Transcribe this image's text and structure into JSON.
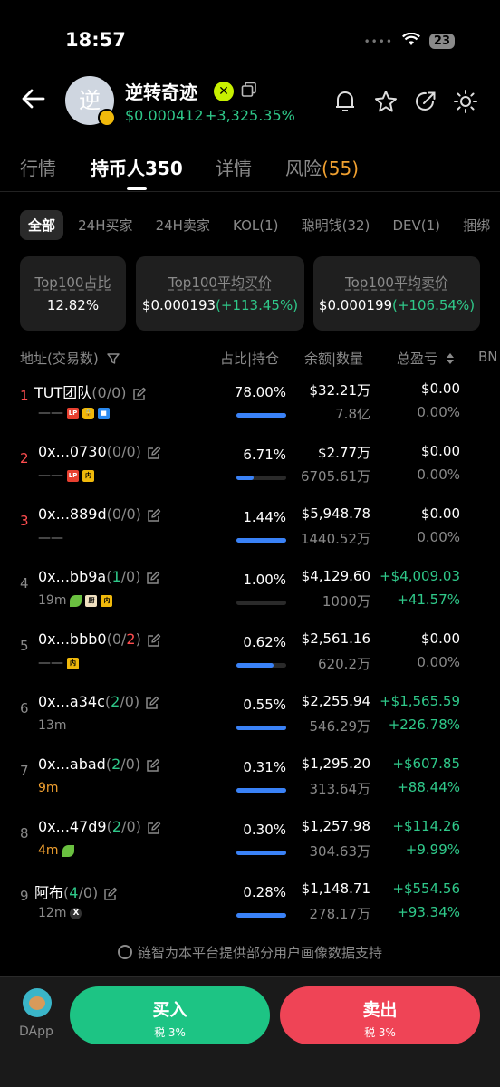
{
  "status": {
    "time": "18:57",
    "battery": "23"
  },
  "token": {
    "avatar_char": "逆",
    "name": "逆转奇迹",
    "price": "$0.000412",
    "change": "+3,325.35%"
  },
  "tabs": [
    {
      "label": "行情"
    },
    {
      "label": "持币人350"
    },
    {
      "label": "详情"
    },
    {
      "label": "风险",
      "count": "(55)"
    }
  ],
  "filters": [
    "全部",
    "24H买家",
    "24H卖家",
    "KOL(1)",
    "聪明钱(32)",
    "DEV(1)",
    "捆绑"
  ],
  "stats": [
    {
      "label": "Top100占比",
      "value": "12.82%",
      "extra": ""
    },
    {
      "label": "Top100平均买价",
      "value": "$0.000193",
      "extra": "(+113.45%)"
    },
    {
      "label": "Top100平均卖价",
      "value": "$0.000199",
      "extra": "(+106.54%)"
    }
  ],
  "table_header": {
    "address": "地址(交易数)",
    "share": "占比|持仓",
    "balance": "余额|数量",
    "pnl": "总盈亏",
    "extra": "BN"
  },
  "rows": [
    {
      "rank": "1",
      "name": "TUT团队",
      "c1": "0",
      "c2": "0",
      "c1_color": "w",
      "c2_color": "w",
      "time": "——",
      "time_color": "",
      "tags": [
        "lp",
        "lock",
        "sq"
      ],
      "pct": "78.00%",
      "share": 1.0,
      "balance": "$32.21万",
      "qty": "7.8亿",
      "pnl": "$0.00",
      "pnl_pct": "0.00%",
      "positive": false
    },
    {
      "rank": "2",
      "name": "0x...0730",
      "c1": "0",
      "c2": "0",
      "c1_color": "w",
      "c2_color": "w",
      "time": "——",
      "time_color": "",
      "tags": [
        "lp",
        "nei"
      ],
      "pct": "6.71%",
      "share": 0.35,
      "balance": "$2.77万",
      "qty": "6705.61万",
      "pnl": "$0.00",
      "pnl_pct": "0.00%",
      "positive": false
    },
    {
      "rank": "3",
      "name": "0x...889d",
      "c1": "0",
      "c2": "0",
      "c1_color": "w",
      "c2_color": "w",
      "time": "——",
      "time_color": "",
      "tags": [],
      "pct": "1.44%",
      "share": 1.0,
      "balance": "$5,948.78",
      "qty": "1440.52万",
      "pnl": "$0.00",
      "pnl_pct": "0.00%",
      "positive": false
    },
    {
      "rank": "4",
      "name": "0x...bb9a",
      "c1": "1",
      "c2": "0",
      "c1_color": "g",
      "c2_color": "w",
      "time": "19m",
      "time_color": "",
      "tags": [
        "leaf",
        "chef",
        "nei"
      ],
      "pct": "1.00%",
      "share": 0.0,
      "balance": "$4,129.60",
      "qty": "1000万",
      "pnl": "+$4,009.03",
      "pnl_pct": "+41.57%",
      "positive": true
    },
    {
      "rank": "5",
      "name": "0x...bbb0",
      "c1": "0",
      "c2": "2",
      "c1_color": "w",
      "c2_color": "r",
      "time": "——",
      "time_color": "",
      "tags": [
        "nei"
      ],
      "pct": "0.62%",
      "share": 0.75,
      "balance": "$2,561.16",
      "qty": "620.2万",
      "pnl": "$0.00",
      "pnl_pct": "0.00%",
      "positive": false
    },
    {
      "rank": "6",
      "name": "0x...a34c",
      "c1": "2",
      "c2": "0",
      "c1_color": "g",
      "c2_color": "w",
      "time": "13m",
      "time_color": "",
      "tags": [],
      "pct": "0.55%",
      "share": 1.0,
      "balance": "$2,255.94",
      "qty": "546.29万",
      "pnl": "+$1,565.59",
      "pnl_pct": "+226.78%",
      "positive": true
    },
    {
      "rank": "7",
      "name": "0x...abad",
      "c1": "2",
      "c2": "0",
      "c1_color": "g",
      "c2_color": "w",
      "time": "9m",
      "time_color": "orange",
      "tags": [],
      "pct": "0.31%",
      "share": 1.0,
      "balance": "$1,295.20",
      "qty": "313.64万",
      "pnl": "+$607.85",
      "pnl_pct": "+88.44%",
      "positive": true
    },
    {
      "rank": "8",
      "name": "0x...47d9",
      "c1": "2",
      "c2": "0",
      "c1_color": "g",
      "c2_color": "w",
      "time": "4m",
      "time_color": "orange",
      "tags": [
        "leaf"
      ],
      "pct": "0.30%",
      "share": 1.0,
      "balance": "$1,257.98",
      "qty": "304.63万",
      "pnl": "+$114.26",
      "pnl_pct": "+9.99%",
      "positive": true
    },
    {
      "rank": "9",
      "name": "阿布",
      "c1": "4",
      "c2": "0",
      "c1_color": "g",
      "c2_color": "w",
      "time": "12m",
      "time_color": "",
      "tags": [
        "x"
      ],
      "pct": "0.28%",
      "share": 1.0,
      "balance": "$1,148.71",
      "qty": "278.17万",
      "pnl": "+$554.56",
      "pnl_pct": "+93.34%",
      "positive": true
    }
  ],
  "footer_note": "链智为本平台提供部分用户画像数据支持",
  "bottom": {
    "dapp": "DApp",
    "buy": "买入",
    "buy_tax": "税 3%",
    "sell": "卖出",
    "sell_tax": "税 3%"
  },
  "colors": {
    "green": "#2fc98a",
    "red": "#ff4d4f",
    "bar": "#3a82f7",
    "buy": "#1dc484",
    "sell": "#ef4456"
  }
}
